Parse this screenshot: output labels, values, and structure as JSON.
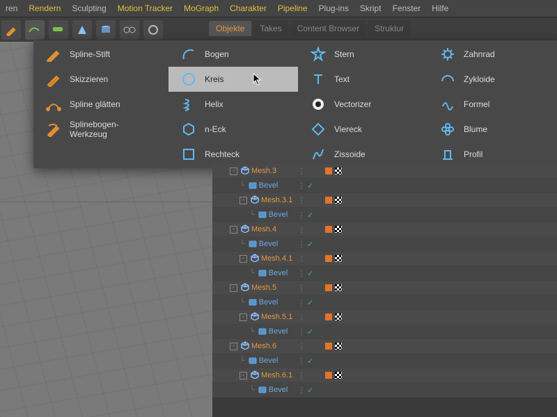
{
  "menu": {
    "items": [
      "ren",
      "Rendern",
      "Sculpting",
      "Motion Tracker",
      "MoGraph",
      "Charakter",
      "Pipeline",
      "Plug-ins",
      "Skript",
      "Fenster",
      "Hilfe"
    ],
    "highlight": [
      1,
      3,
      4,
      5,
      6
    ]
  },
  "tabs": {
    "items": [
      "Objekte",
      "Takes",
      "Content Browser",
      "Struktur"
    ],
    "active": 0
  },
  "flyout": {
    "cols": [
      [
        {
          "icon": "pen",
          "label": "Spline-Stift"
        },
        {
          "icon": "pen2",
          "label": "Skizzieren"
        },
        {
          "icon": "smooth",
          "label": "Spline glätten"
        },
        {
          "icon": "arcpen",
          "label": "Splinebogen-Werkzeug"
        }
      ],
      [
        {
          "icon": "arc",
          "label": "Bogen"
        },
        {
          "icon": "circle",
          "label": "Kreis",
          "hover": true
        },
        {
          "icon": "helix",
          "label": "Helix"
        },
        {
          "icon": "hexagon",
          "label": "n-Eck"
        },
        {
          "icon": "square",
          "label": "Rechteck"
        }
      ],
      [
        {
          "icon": "star",
          "label": "Stern"
        },
        {
          "icon": "text",
          "label": "Text"
        },
        {
          "icon": "vector",
          "label": "Vectorizer"
        },
        {
          "icon": "diamond",
          "label": "Viereck"
        },
        {
          "icon": "ziss",
          "label": "Zissoide"
        }
      ],
      [
        {
          "icon": "gear",
          "label": "Zahnrad"
        },
        {
          "icon": "cycloid",
          "label": "Zykloide"
        },
        {
          "icon": "formula",
          "label": "Formel"
        },
        {
          "icon": "flower",
          "label": "Blume"
        },
        {
          "icon": "profile",
          "label": "Profil"
        }
      ]
    ]
  },
  "tree": [
    {
      "d": 1,
      "t": "mesh",
      "name": "Mesh.3",
      "exp": "-",
      "tags": [
        "o",
        "c"
      ]
    },
    {
      "d": 2,
      "t": "bev",
      "name": "Bevel",
      "chk": true
    },
    {
      "d": 2,
      "t": "mesh",
      "name": "Mesh.3.1",
      "exp": "-",
      "tags": [
        "o",
        "c"
      ]
    },
    {
      "d": 3,
      "t": "bev",
      "name": "Bevel",
      "chk": true
    },
    {
      "d": 1,
      "t": "mesh",
      "name": "Mesh.4",
      "exp": "-",
      "tags": [
        "o",
        "c"
      ]
    },
    {
      "d": 2,
      "t": "bev",
      "name": "Bevel",
      "chk": true
    },
    {
      "d": 2,
      "t": "mesh",
      "name": "Mesh.4.1",
      "exp": "-",
      "tags": [
        "o",
        "c"
      ]
    },
    {
      "d": 3,
      "t": "bev",
      "name": "Bevel",
      "chk": true
    },
    {
      "d": 1,
      "t": "mesh",
      "name": "Mesh.5",
      "exp": "-",
      "tags": [
        "o",
        "c"
      ]
    },
    {
      "d": 2,
      "t": "bev",
      "name": "Bevel",
      "chk": true
    },
    {
      "d": 2,
      "t": "mesh",
      "name": "Mesh.5.1",
      "exp": "-",
      "tags": [
        "o",
        "c"
      ]
    },
    {
      "d": 3,
      "t": "bev",
      "name": "Bevel",
      "chk": true
    },
    {
      "d": 1,
      "t": "mesh",
      "name": "Mesh.6",
      "exp": "-",
      "tags": [
        "o",
        "c"
      ]
    },
    {
      "d": 2,
      "t": "bev",
      "name": "Bevel",
      "chk": true
    },
    {
      "d": 2,
      "t": "mesh",
      "name": "Mesh.6.1",
      "exp": "-",
      "tags": [
        "o",
        "c"
      ]
    },
    {
      "d": 3,
      "t": "bev",
      "name": "Bevel",
      "chk": true
    }
  ]
}
